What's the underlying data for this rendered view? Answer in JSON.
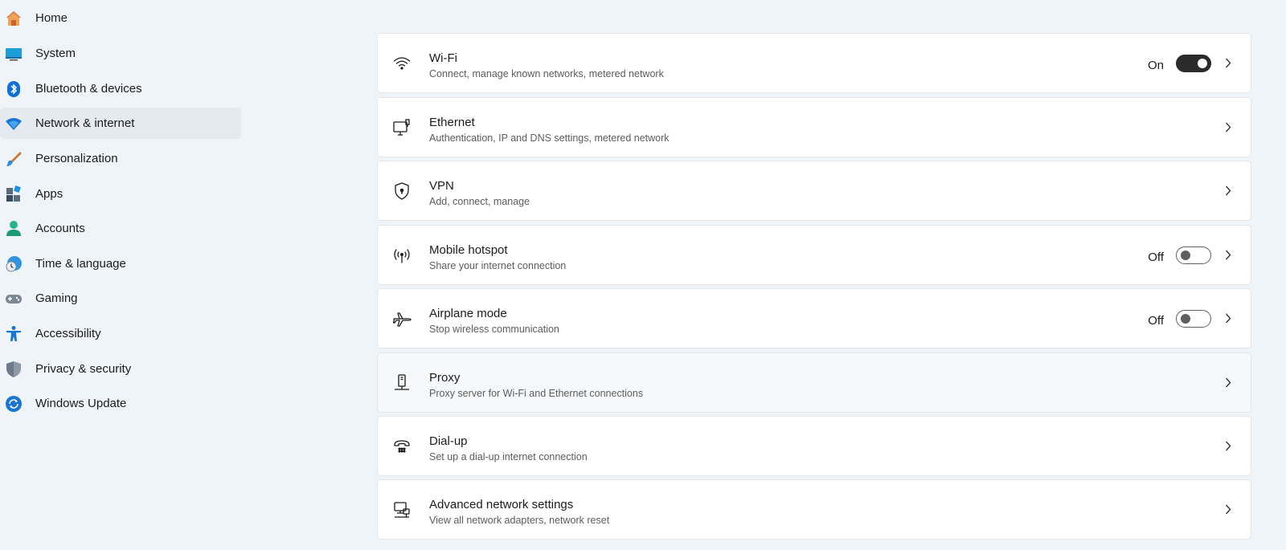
{
  "sidebar": {
    "items": [
      {
        "label": "Home",
        "icon": "home-icon"
      },
      {
        "label": "System",
        "icon": "system-icon"
      },
      {
        "label": "Bluetooth & devices",
        "icon": "bluetooth-icon"
      },
      {
        "label": "Network & internet",
        "icon": "network-icon",
        "selected": true
      },
      {
        "label": "Personalization",
        "icon": "brush-icon"
      },
      {
        "label": "Apps",
        "icon": "apps-icon"
      },
      {
        "label": "Accounts",
        "icon": "person-icon"
      },
      {
        "label": "Time & language",
        "icon": "clock-globe-icon"
      },
      {
        "label": "Gaming",
        "icon": "gamepad-icon"
      },
      {
        "label": "Accessibility",
        "icon": "accessibility-icon"
      },
      {
        "label": "Privacy & security",
        "icon": "shield-icon"
      },
      {
        "label": "Windows Update",
        "icon": "update-icon"
      }
    ]
  },
  "cards": [
    {
      "title": "Wi-Fi",
      "subtitle": "Connect, manage known networks, metered network",
      "icon": "wifi-icon",
      "state": "On"
    },
    {
      "title": "Ethernet",
      "subtitle": "Authentication, IP and DNS settings, metered network",
      "icon": "ethernet-icon"
    },
    {
      "title": "VPN",
      "subtitle": "Add, connect, manage",
      "icon": "vpn-shield-icon"
    },
    {
      "title": "Mobile hotspot",
      "subtitle": "Share your internet connection",
      "icon": "hotspot-icon",
      "state": "Off"
    },
    {
      "title": "Airplane mode",
      "subtitle": "Stop wireless communication",
      "icon": "airplane-icon",
      "state": "Off"
    },
    {
      "title": "Proxy",
      "subtitle": "Proxy server for Wi-Fi and Ethernet connections",
      "icon": "proxy-icon"
    },
    {
      "title": "Dial-up",
      "subtitle": "Set up a dial-up internet connection",
      "icon": "dialup-icon"
    },
    {
      "title": "Advanced network settings",
      "subtitle": "View all network adapters, network reset",
      "icon": "advanced-network-icon"
    }
  ],
  "colors": {
    "background": "#eff4f9",
    "card": "#ffffff",
    "accent": "#0067c0",
    "toggle_on": "#2b2b2b"
  }
}
